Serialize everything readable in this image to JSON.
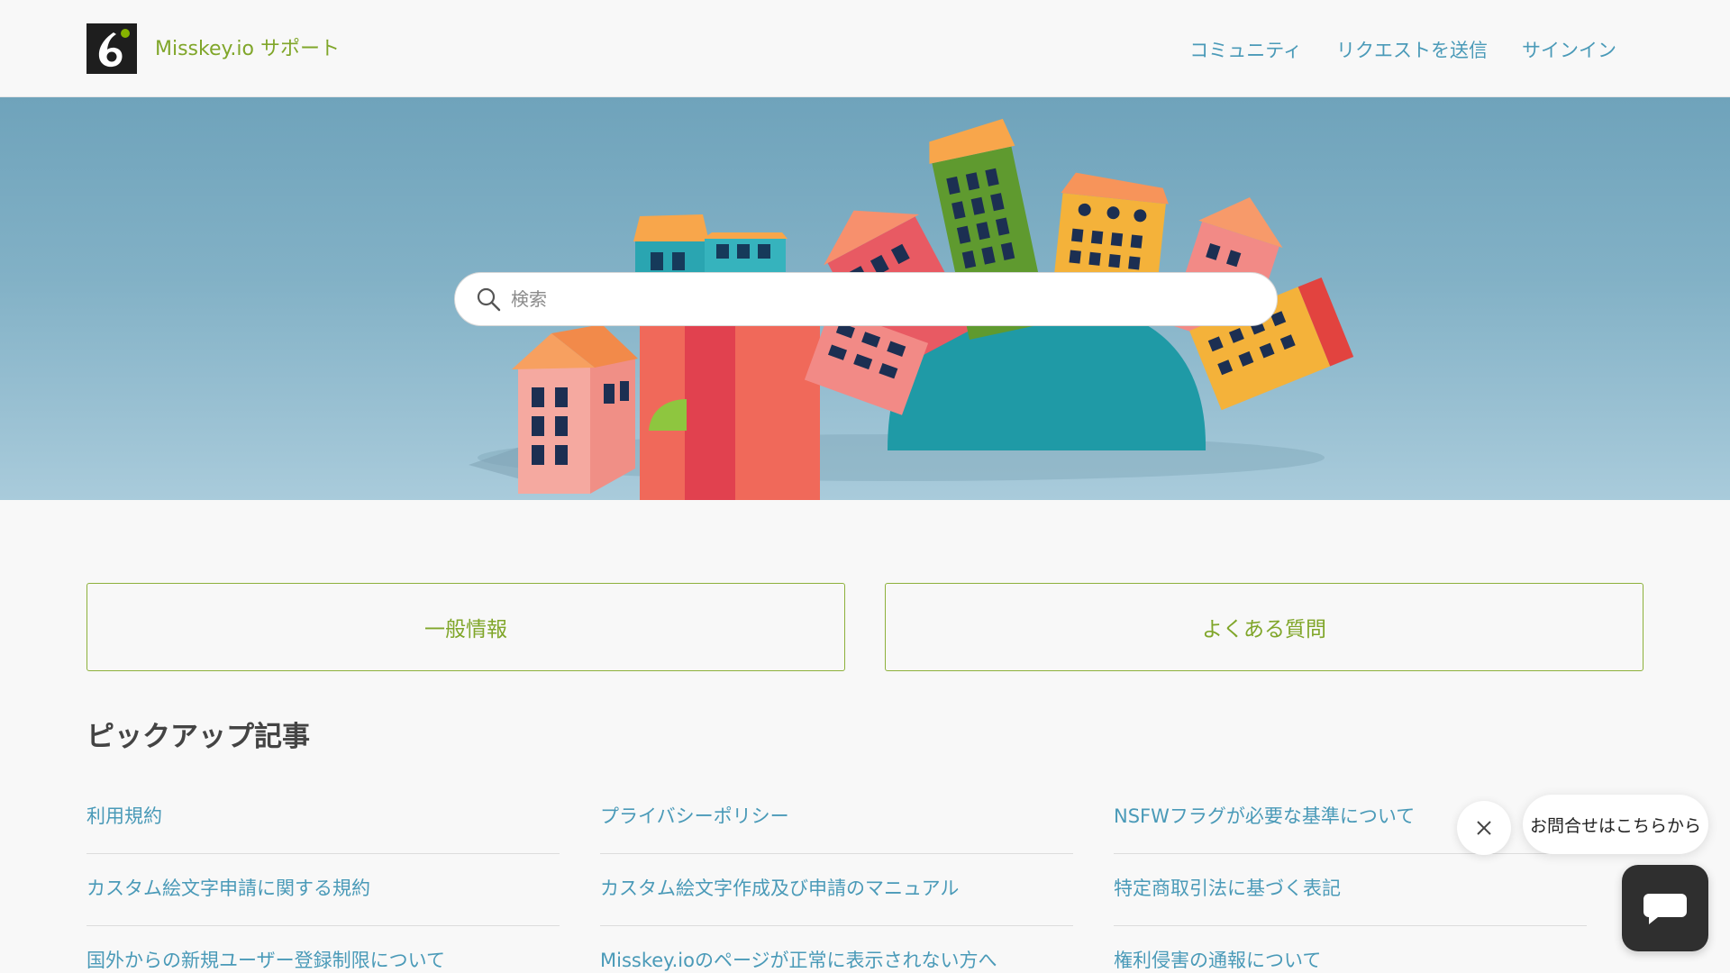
{
  "header": {
    "brand": "Misskey.io サポート",
    "nav": {
      "community": "コミュニティ",
      "request": "リクエストを送信",
      "signin": "サインイン"
    }
  },
  "search": {
    "placeholder": "検索"
  },
  "categories": {
    "general": "一般情報",
    "faq": "よくある質問"
  },
  "pickup": {
    "title": "ピックアップ記事",
    "columns": [
      [
        "利用規約",
        "カスタム絵文字申請に関する規約",
        "国外からの新規ユーザー登録制限について"
      ],
      [
        "プライバシーポリシー",
        "カスタム絵文字作成及び申請のマニュアル",
        "Misskey.ioのページが正常に表示されない方へ"
      ],
      [
        "NSFWフラグが必要な基準について",
        "特定商取引法に基づく表記",
        "権利侵害の通報について"
      ]
    ]
  },
  "chat": {
    "bubble": "お問合せはこちらから"
  },
  "colors": {
    "accent": "#80a62a",
    "link": "#4a9ab8",
    "border": "#8db13b"
  },
  "icons": {
    "logo": "misskey-logo-icon",
    "search": "search-icon",
    "close": "close-icon",
    "chat": "chat-icon"
  }
}
